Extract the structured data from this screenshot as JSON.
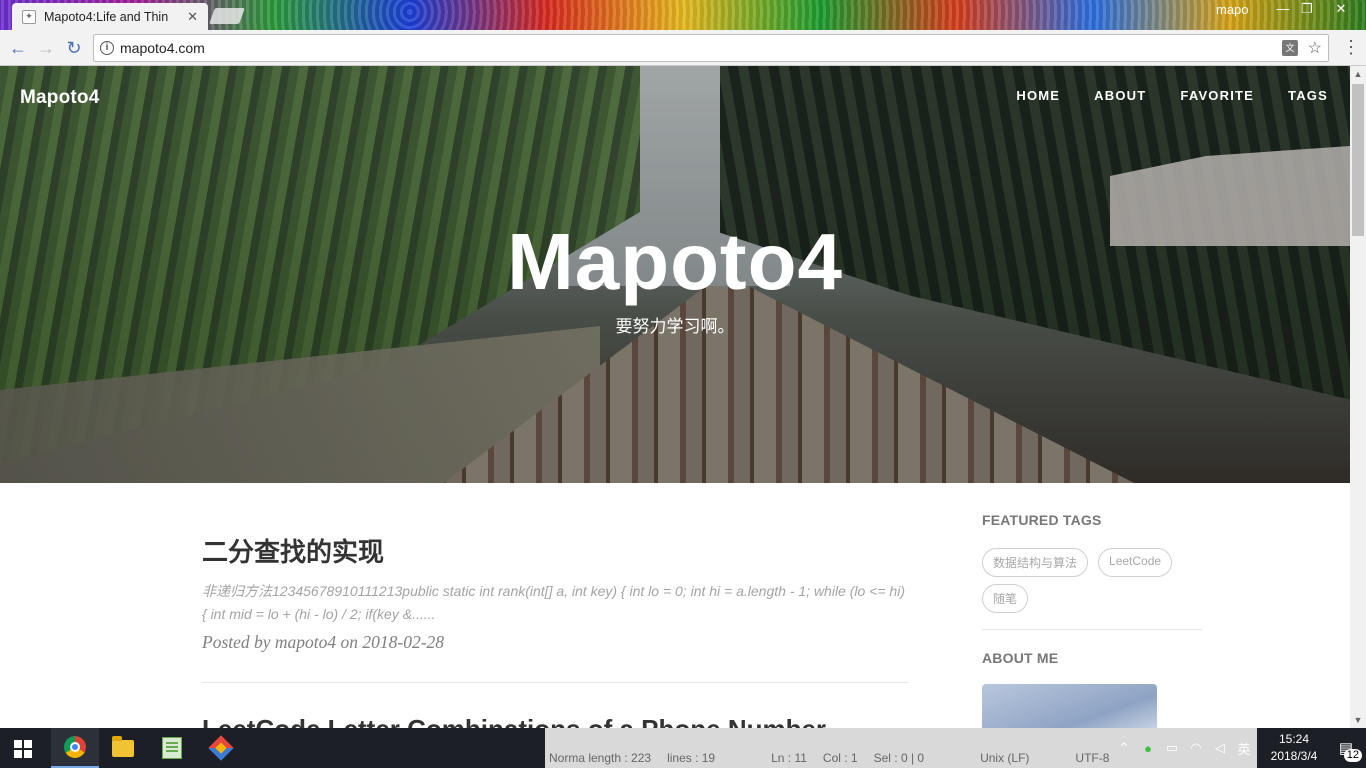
{
  "browser": {
    "tab_title": "Mapoto4:Life and Thin",
    "user_name": "mapo",
    "url": "mapoto4.com"
  },
  "site": {
    "brand": "Mapoto4",
    "nav": [
      {
        "label": "HOME"
      },
      {
        "label": "ABOUT"
      },
      {
        "label": "FAVORITE"
      },
      {
        "label": "TAGS"
      }
    ],
    "hero_title": "Mapoto4",
    "hero_subtitle": "要努力学习啊。"
  },
  "posts": [
    {
      "title": "二分查找的实现",
      "excerpt": "非递归方法12345678910111213public static int rank(int[] a, int key) { int lo = 0; int hi = a.length - 1; while (lo <= hi) { int mid = lo + (hi - lo) / 2; if(key &......",
      "meta": "Posted by mapoto4 on 2018-02-28"
    },
    {
      "title": "LeetCode Letter Combinations of a Phone Number"
    }
  ],
  "sidebar": {
    "featured_tags_heading": "FEATURED TAGS",
    "tags": [
      {
        "label": "数据结构与算法"
      },
      {
        "label": "LeetCode"
      },
      {
        "label": "随笔"
      }
    ],
    "about_heading": "ABOUT ME"
  },
  "taskbar": {
    "editor_status": {
      "normal_length": "Norma length : 223",
      "lines": "lines : 19",
      "ln": "Ln : 11",
      "col": "Col : 1",
      "sel": "Sel : 0 | 0",
      "eol": "Unix (LF)",
      "encoding": "UTF-8"
    },
    "ime": "英",
    "time": "15:24",
    "date": "2018/3/4",
    "notifications": "12"
  },
  "colors": {
    "taskbar": "#1c1f26",
    "link_accent": "#4a6fb5",
    "post_title": "#333333",
    "excerpt": "#a3a3a3"
  }
}
